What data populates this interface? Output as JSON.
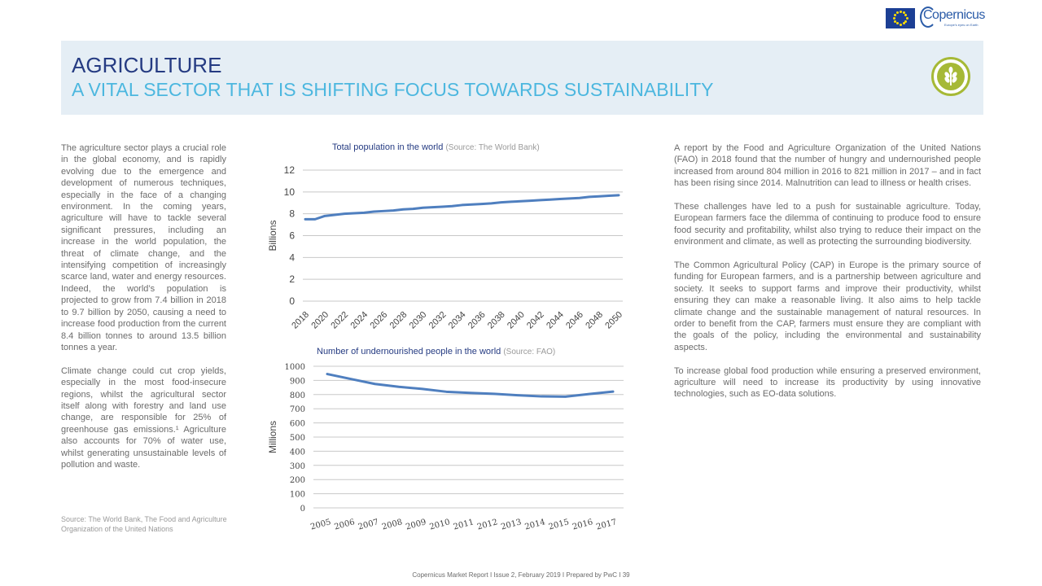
{
  "header": {
    "title": "AGRICULTURE",
    "subtitle": "A VITAL SECTOR THAT IS SHIFTING FOCUS TOWARDS SUSTAINABILITY"
  },
  "logo": {
    "wordmark": "Copernicus",
    "tagline": "Europe's eyes on Earth"
  },
  "left_column": {
    "paragraphs": [
      "The agriculture sector plays a crucial role in the global economy, and is rapidly evolving due to the emergence and development of numerous techniques, especially in the face of a changing environment. In the coming years, agriculture will have to tackle several significant pressures, including an increase in the world population, the threat of climate change, and the intensifying competition of increasingly scarce land, water and energy resources. Indeed, the world’s population is projected to grow from 7.4 billion in 2018 to 9.7 billion by 2050, causing a need to increase food production from the current 8.4 billion tonnes to around 13.5 billion tonnes a year.",
      "Climate change could cut crop yields, especially in the most food-insecure regions, whilst the agricultural sector itself along with forestry and land use change, are responsible for 25% of greenhouse gas emissions.¹ Agriculture also accounts for 70% of water use, whilst generating unsustainable levels of pollution and waste."
    ],
    "source": "Source: The World Bank, The Food and Agriculture Organization of the United Nations"
  },
  "right_column": {
    "paragraphs": [
      "A report by the Food and Agriculture Organization of the United Nations (FAO) in 2018 found that the number of hungry and undernourished people increased from around 804 million in 2016 to 821 million in 2017 – and in fact has been rising since 2014. Malnutrition can lead to illness or health crises.",
      "These challenges have led to a push for sustainable agriculture. Today, European farmers face the dilemma of continuing to produce food to ensure food security and profitability, whilst also trying to reduce their impact on the environment and climate, as well as protecting the surrounding biodiversity.",
      "The Common Agricultural Policy (CAP) in Europe is the primary source of funding for European farmers, and is a partnership between agriculture and society. It seeks to support farms and improve their productivity, whilst ensuring they can make a reasonable living. It also aims to help tackle climate change and the sustainable management of natural resources. In order to benefit from the CAP, farmers must ensure they are compliant with the goals of the policy, including the environmental and sustainability aspects.",
      "To increase global food production while ensuring a preserved environment, agriculture will need to increase its productivity by using innovative technologies, such as EO-data solutions."
    ]
  },
  "footer": "Copernicus Market Report I Issue 2, February 2019 I Prepared by PwC I     39",
  "colors": {
    "line": "#4f7fbf",
    "title_dark": "#253b82",
    "title_light": "#4cb7df",
    "band": "#e5eef5",
    "badge": "#a6b936"
  },
  "icons": [
    "eu-flag-icon",
    "wheat-icon"
  ],
  "chart_data": [
    {
      "type": "line",
      "title": "Total population in the world",
      "source": "(Source: The World Bank)",
      "ylabel": "Billions",
      "ylim": [
        0,
        12
      ],
      "yticks": [
        0,
        2,
        4,
        6,
        8,
        10,
        12
      ],
      "xticks": [
        "2018",
        "2020",
        "2022",
        "2024",
        "2026",
        "2028",
        "2030",
        "2032",
        "2034",
        "2036",
        "2038",
        "2040",
        "2042",
        "2044",
        "2046",
        "2048",
        "2050"
      ],
      "x": [
        2018,
        2019,
        2020,
        2021,
        2022,
        2023,
        2024,
        2025,
        2026,
        2027,
        2028,
        2029,
        2030,
        2031,
        2032,
        2033,
        2034,
        2035,
        2036,
        2037,
        2038,
        2039,
        2040,
        2041,
        2042,
        2043,
        2044,
        2045,
        2046,
        2047,
        2048,
        2049,
        2050
      ],
      "values": [
        7.5,
        7.5,
        7.8,
        7.9,
        8.0,
        8.05,
        8.1,
        8.2,
        8.25,
        8.3,
        8.4,
        8.45,
        8.55,
        8.6,
        8.65,
        8.7,
        8.8,
        8.85,
        8.9,
        8.95,
        9.05,
        9.1,
        9.15,
        9.2,
        9.25,
        9.3,
        9.35,
        9.4,
        9.45,
        9.55,
        9.6,
        9.65,
        9.7
      ]
    },
    {
      "type": "line",
      "title": "Number of undernourished people in the world",
      "source": "(Source: FAO)",
      "ylabel": "Millions",
      "ylim": [
        0,
        1000
      ],
      "yticks": [
        0,
        100,
        200,
        300,
        400,
        500,
        600,
        700,
        800,
        900,
        1000
      ],
      "xticks": [
        "2005",
        "2006",
        "2007",
        "2008",
        "2009",
        "2010",
        "2011",
        "2012",
        "2013",
        "2014",
        "2015",
        "2016",
        "2017"
      ],
      "values": [
        945,
        910,
        875,
        855,
        840,
        820,
        812,
        805,
        795,
        787,
        785,
        804,
        821
      ]
    }
  ]
}
